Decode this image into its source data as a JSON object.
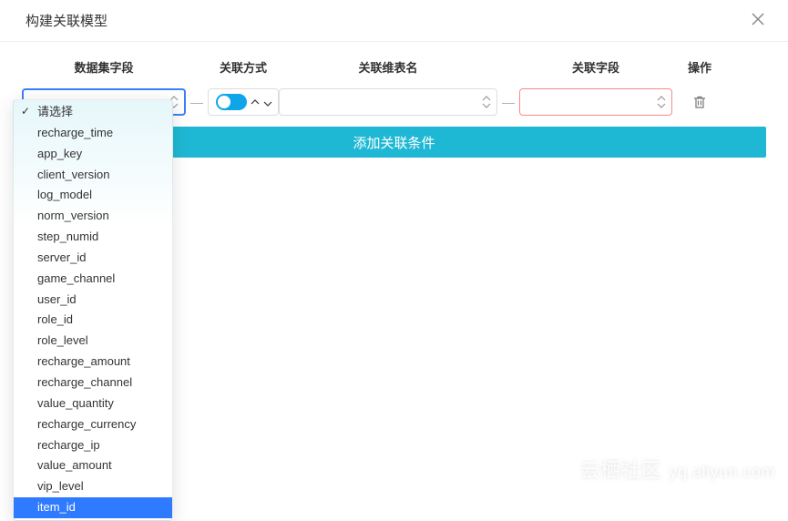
{
  "header": {
    "title": "构建关联模型"
  },
  "columns": {
    "field": "数据集字段",
    "method": "关联方式",
    "table": "关联维表名",
    "linkfield": "关联字段",
    "action": "操作"
  },
  "row": {
    "field_value": "",
    "table_value": "",
    "linkfield_value": "",
    "dash": "—"
  },
  "add_button": "添加关联条件",
  "dropdown": {
    "placeholder": "请选择",
    "options": [
      "recharge_time",
      "app_key",
      "client_version",
      "log_model",
      "norm_version",
      "step_numid",
      "server_id",
      "game_channel",
      "user_id",
      "role_id",
      "role_level",
      "recharge_amount",
      "recharge_channel",
      "value_quantity",
      "recharge_currency",
      "recharge_ip",
      "value_amount",
      "vip_level",
      "item_id"
    ],
    "selected": "item_id"
  },
  "watermark": {
    "text1": "云栖社区",
    "text2": "yq.aliyun.com"
  }
}
